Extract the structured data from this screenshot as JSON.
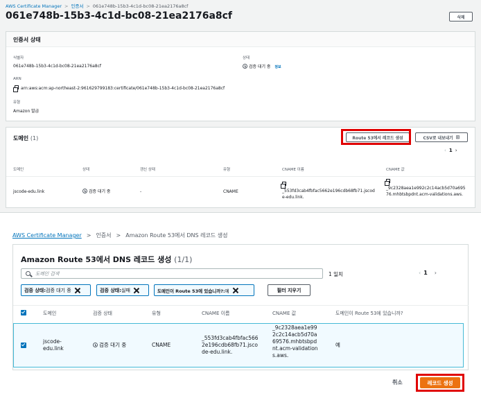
{
  "top": {
    "breadcrumbs": [
      "AWS Certificate Manager",
      "인증서",
      "061e748b-15b3-4c1d-bc08-21ea2176a8cf"
    ],
    "title": "061e748b-15b3-4c1d-bc08-21ea2176a8cf",
    "delete_label": "삭제",
    "status_panel": {
      "title": "인증서 상태",
      "identifier_label": "식별자",
      "identifier_value": "061e748b-15b3-4c1d-bc08-21ea2176a8cf",
      "status_label": "상태",
      "status_value": "검증 대기 중",
      "info_link": "정보",
      "arn_label": "ARN",
      "arn_value": "arn:aws:acm:ap-northeast-2:961629799183:certificate/061e748b-15b3-4c1d-bc08-21ea2176a8cf",
      "type_label": "유형",
      "type_value": "Amazon 발급"
    },
    "domains_panel": {
      "title": "도메인",
      "count": "(1)",
      "route53_button": "Route 53에서 레코드 생성",
      "csv_button": "CSV로 내보내기",
      "page": "1",
      "columns": [
        "도메인",
        "상태",
        "갱신 상태",
        "유형",
        "CNAME 이름",
        "CNAME 값"
      ],
      "row": {
        "domain": "jscode-edu.link",
        "status": "검증 대기 중",
        "renewal": "-",
        "type": "CNAME",
        "cname_name": "_553fd3cab4fbfac5662e196cdb68fb71.jscode-edu.link.",
        "cname_value": "_9c2328aea1e992c2c14acb5d70a69576.mhbtsbpdnt.acm-validations.aws."
      }
    }
  },
  "bottom": {
    "breadcrumbs": [
      "AWS Certificate Manager",
      "인증서",
      "Amazon Route 53에서 DNS 레코드 생성"
    ],
    "title": "Amazon Route 53에서 DNS 레코드 생성",
    "title_count": "(1/1)",
    "search_placeholder": "도메인 검색",
    "match_count": "1 일치",
    "page": "1",
    "filters": [
      {
        "key": "검증 상태:",
        "value": " 검증 대기 중"
      },
      {
        "key": "검증 상태:",
        "value": " 실패"
      },
      {
        "key": "도메인이 Route 53에 있습니까?:",
        "value": " 예"
      }
    ],
    "clear_filters": "필터 지우기",
    "columns": [
      "도메인",
      "검증 상태",
      "유형",
      "CNAME 이름",
      "CNAME 값",
      "도메인이 Route 53에 있습니까?"
    ],
    "row": {
      "domain": "jscode-edu.link",
      "status": "검증 대기 중",
      "type": "CNAME",
      "cname_name": "_553fd3cab4fbfac5662e196cdb68fb71.jscode-edu.link.",
      "cname_value": "_9c2328aea1e992c2c14acb5d70a69576.mhbtsbpdnt.acm-validations.aws.",
      "in_route53": "예"
    },
    "cancel_label": "취소",
    "create_label": "레코드 생성"
  }
}
